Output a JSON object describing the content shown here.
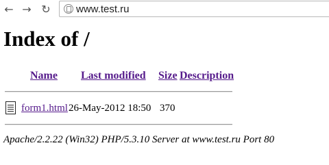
{
  "browser": {
    "back_icon": "back-arrow-icon",
    "forward_icon": "forward-arrow-icon",
    "reload_icon": "reload-icon",
    "page_icon": "page-icon",
    "url": "www.test.ru"
  },
  "page": {
    "heading": "Index of /",
    "columns": {
      "name": "Name",
      "last_modified": "Last modified",
      "size": "Size",
      "description": "Description"
    },
    "rows": [
      {
        "icon": "file-icon",
        "name": "form1.html",
        "last_modified": "26-May-2012 18:50",
        "size": "370"
      }
    ],
    "footer": "Apache/2.2.22 (Win32) PHP/5.3.10 Server at www.test.ru Port 80"
  },
  "colors": {
    "link_visited": "#551a8b",
    "rule": "#9a9a9a"
  }
}
